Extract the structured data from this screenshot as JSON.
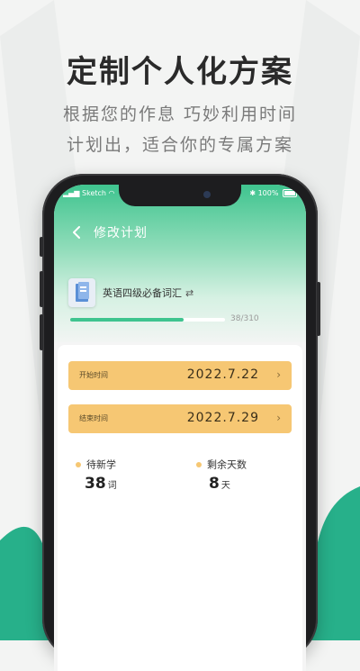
{
  "promo": {
    "title": "定制个人化方案",
    "subtitle_line1": "根据您的作息  巧妙利用时间",
    "subtitle_line2": "计划出，适合你的专属方案"
  },
  "status_bar": {
    "carrier": "Sketch",
    "battery": "100%"
  },
  "header": {
    "title": "修改计划",
    "back_icon": "chevron-left-icon"
  },
  "book": {
    "name": "英语四级必备词汇",
    "swap_icon": "swap-icon",
    "progress_text": "38/310",
    "progress_fraction": 0.73
  },
  "plan": {
    "start_label": "开始时间",
    "start_value": "2022.7.22",
    "end_label": "结束时间",
    "end_value": "2022.7.29"
  },
  "stats": {
    "pending_label": "待新学",
    "pending_value": "38",
    "pending_unit": "词",
    "remaining_label": "剩余天数",
    "remaining_value": "8",
    "remaining_unit": "天"
  },
  "colors": {
    "accent_green": "#3fc48f",
    "highlight_yellow": "#f6c773",
    "deco_green": "#27b08a"
  }
}
